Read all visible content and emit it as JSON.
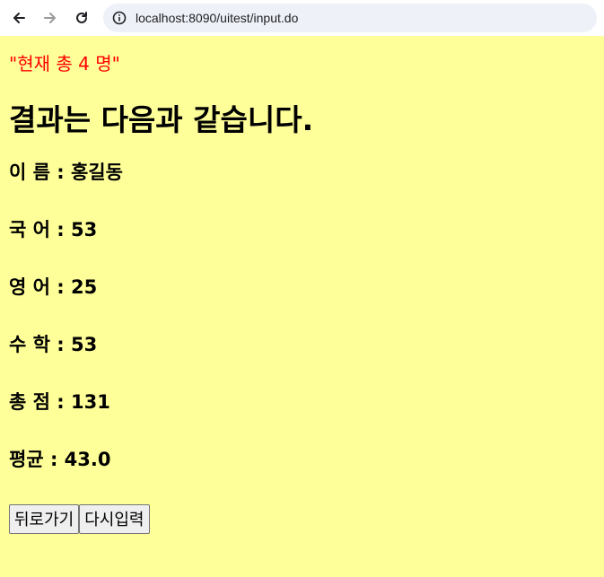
{
  "browser": {
    "url": "localhost:8090/uitest/input.do"
  },
  "page": {
    "count_text": "\"현재 총 4 명\"",
    "heading": "결과는 다음과 같습니다.",
    "results": [
      {
        "text": "이 름 : 홍길동"
      },
      {
        "text": "국 어 : 53"
      },
      {
        "text": "영 어 : 25"
      },
      {
        "text": "수 학 : 53"
      },
      {
        "text": "총 점 : 131"
      },
      {
        "text": "평균 : 43.0"
      }
    ],
    "buttons": {
      "back_label": "뒤로가기",
      "reenter_label": "다시입력"
    }
  },
  "colors": {
    "background": "#ffff99",
    "count_text": "#ff0000"
  }
}
